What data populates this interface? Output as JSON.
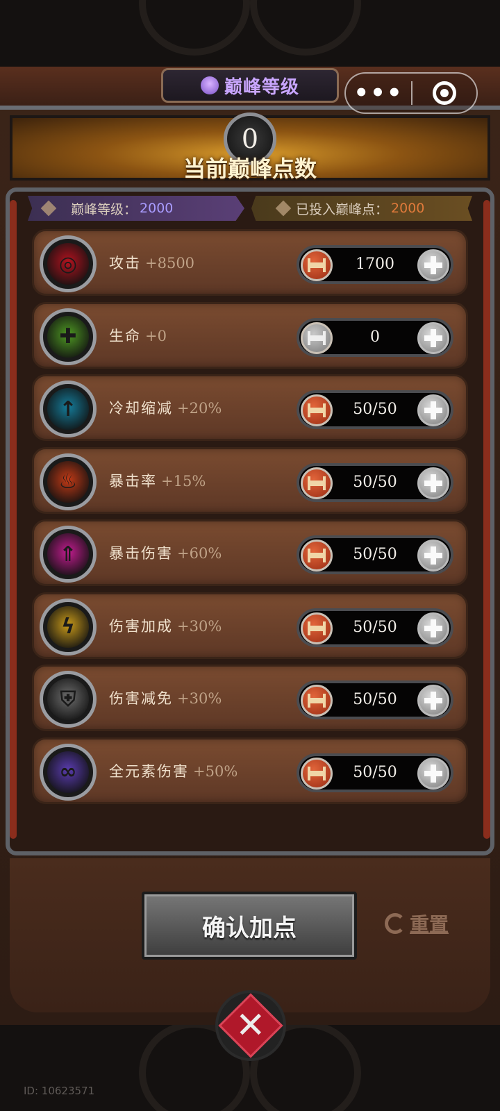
{
  "header": {
    "title": "巅峰等级",
    "title_icon": "hat-icon",
    "capsule_menu": "•••",
    "capsule_close_icon": "target-icon"
  },
  "points": {
    "current": "0",
    "label": "当前巅峰点数"
  },
  "info": {
    "level_label": "巅峰等级：",
    "level_value": "2000",
    "invested_label": "已投入巅峰点：",
    "invested_value": "2000"
  },
  "stats": [
    {
      "name": "攻击",
      "bonus": "+8500",
      "value": "1700",
      "icon": "attack-target-icon",
      "color": "#b3131f",
      "minus_enabled": true
    },
    {
      "name": "生命",
      "bonus": "+0",
      "value": "0",
      "icon": "life-plus-icon",
      "color": "#4f9a23",
      "minus_enabled": false
    },
    {
      "name": "冷却缩减",
      "bonus": "+20%",
      "value": "50/50",
      "icon": "cooldown-clock-icon",
      "color": "#157c9a",
      "minus_enabled": true
    },
    {
      "name": "暴击率",
      "bonus": "+15%",
      "value": "50/50",
      "icon": "crit-rate-flame-icon",
      "color": "#c23a16",
      "minus_enabled": true
    },
    {
      "name": "暴击伤害",
      "bonus": "+60%",
      "value": "50/50",
      "icon": "crit-damage-arrow-icon",
      "color": "#c21c8f",
      "minus_enabled": true
    },
    {
      "name": "伤害加成",
      "bonus": "+30%",
      "value": "50/50",
      "icon": "damage-bonus-lightning-icon",
      "color": "#c89a1a",
      "minus_enabled": true
    },
    {
      "name": "伤害减免",
      "bonus": "+30%",
      "value": "50/50",
      "icon": "damage-reduction-shield-icon",
      "color": "#6d6d6d",
      "minus_enabled": true
    },
    {
      "name": "全元素伤害",
      "bonus": "+50%",
      "value": "50/50",
      "icon": "all-element-orbs-icon",
      "color": "#5a3cb0",
      "minus_enabled": true
    }
  ],
  "actions": {
    "confirm_label": "确认加点",
    "reset_label": "重置"
  },
  "footer": {
    "id_text": "ID: 10623571"
  }
}
